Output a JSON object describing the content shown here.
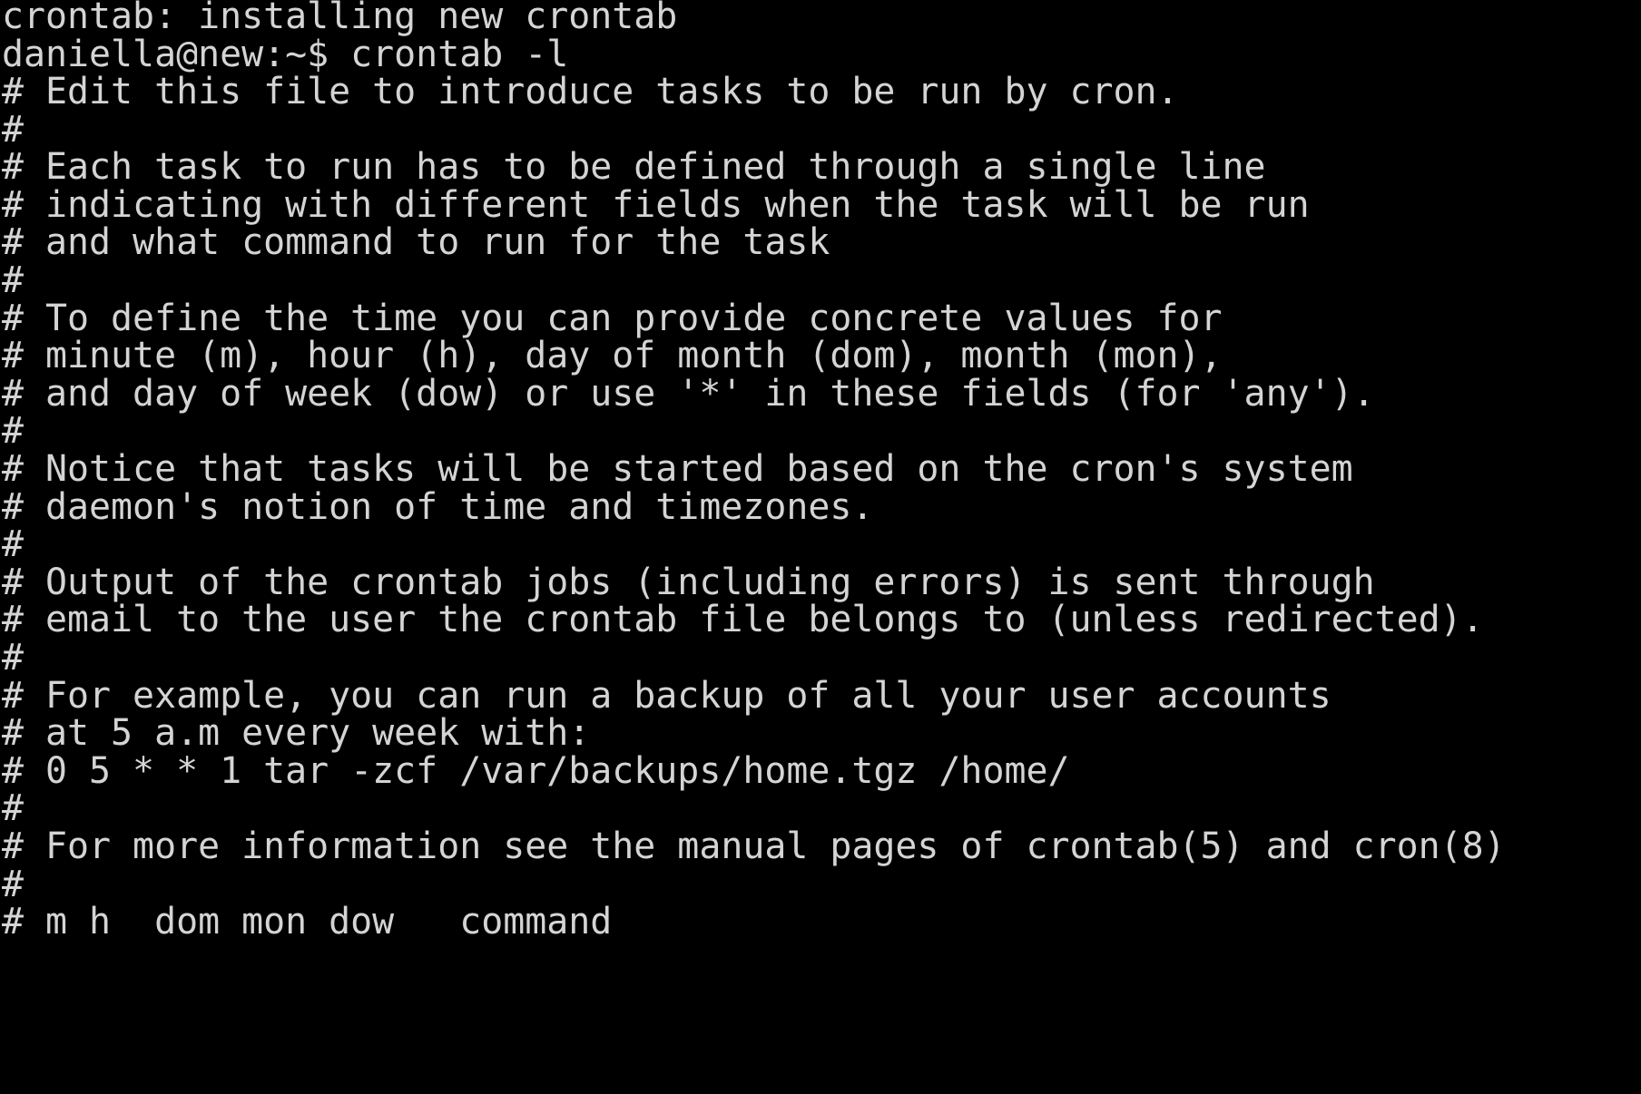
{
  "terminal": {
    "background_color": "#000000",
    "text_color": "#d4d4d4",
    "lines": [
      "crontab: installing new crontab",
      "daniella@new:~$ crontab -l",
      "# Edit this file to introduce tasks to be run by cron.",
      "#",
      "# Each task to run has to be defined through a single line",
      "# indicating with different fields when the task will be run",
      "# and what command to run for the task",
      "#",
      "# To define the time you can provide concrete values for",
      "# minute (m), hour (h), day of month (dom), month (mon),",
      "# and day of week (dow) or use '*' in these fields (for 'any').",
      "#",
      "# Notice that tasks will be started based on the cron's system",
      "# daemon's notion of time and timezones.",
      "#",
      "# Output of the crontab jobs (including errors) is sent through",
      "# email to the user the crontab file belongs to (unless redirected).",
      "#",
      "# For example, you can run a backup of all your user accounts",
      "# at 5 a.m every week with:",
      "# 0 5 * * 1 tar -zcf /var/backups/home.tgz /home/",
      "#",
      "# For more information see the manual pages of crontab(5) and cron(8)",
      "#",
      "# m h  dom mon dow   command"
    ]
  }
}
